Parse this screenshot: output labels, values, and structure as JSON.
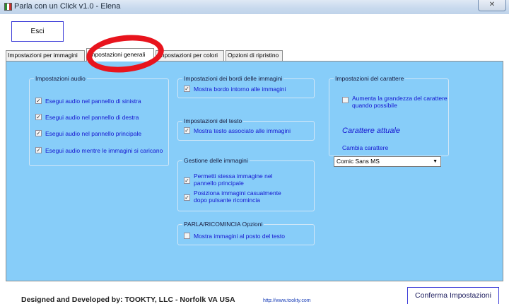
{
  "window": {
    "title": "Parla con un Click v1.0 - Elena",
    "close_glyph": "✕"
  },
  "exit_button": "Esci",
  "tabs": [
    "Impostazioni per immagini",
    "Impostazioni generali",
    "Impostazioni per colori",
    "Opzioni di ripristino"
  ],
  "active_tab": "Impostazioni generali",
  "groups": {
    "audio": {
      "title": "Impostazioni audio",
      "items": [
        {
          "label": "Esegui audio nel pannello di sinistra",
          "checked": true
        },
        {
          "label": "Esegui audio nel pannello di destra",
          "checked": true
        },
        {
          "label": "Esegui audio nel pannello principale",
          "checked": true
        },
        {
          "label": "Esegui audio mentre le immagini si caricano",
          "checked": true
        }
      ]
    },
    "borders": {
      "title": "Impostazioni dei bordi delle immagini",
      "items": [
        {
          "label": "Mostra bordo intorno alle immagini",
          "checked": true
        }
      ]
    },
    "text": {
      "title": "Impostazioni del testo",
      "items": [
        {
          "label": "Mostra testo associato alle immagini",
          "checked": true
        }
      ]
    },
    "management": {
      "title": "Gestione delle immagini",
      "items": [
        {
          "line1": "Permetti stessa immagine nel",
          "line2": "pannello principale",
          "checked": true
        },
        {
          "line1": "Posiziona immagini casualmente",
          "line2": "dopo pulsante ricomincia",
          "checked": true
        }
      ]
    },
    "parla": {
      "title": "PARLA/RICOMINCIA Opzioni",
      "items": [
        {
          "label": "Mostra immagini al posto del testo",
          "checked": false
        }
      ]
    },
    "font": {
      "title": "Impostazioni del carattere",
      "increase": {
        "line1": "Aumenta la grandezza del carattere",
        "line2": "quando possibile",
        "checked": false
      },
      "current_font_label": "Carattere attuale",
      "change_font_label": "Cambia carattere",
      "selected_font": "Comic Sans MS"
    }
  },
  "footer": {
    "credit": "Designed and Developed by: TOOKTY, LLC - Norfolk VA USA",
    "link": "http://www.tookty.com"
  },
  "confirm_button": "Conferma Impostazioni",
  "colors": {
    "panel": "#87cdf9",
    "option_text": "#1515d0",
    "annotation": "#e8141d"
  }
}
